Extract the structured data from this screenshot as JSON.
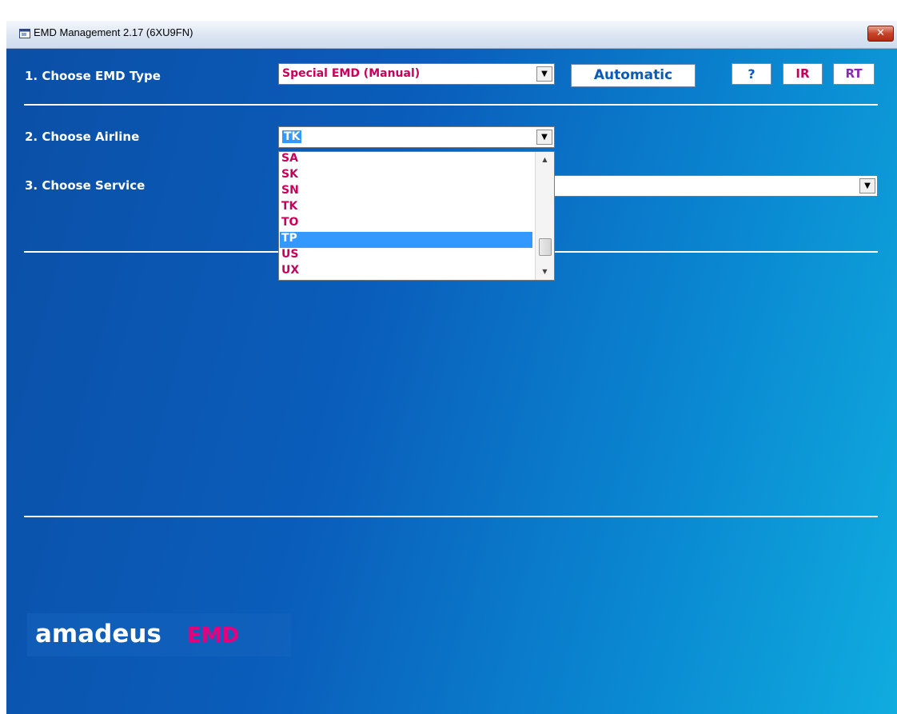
{
  "window": {
    "title": "EMD Management 2.17 (6XU9FN)",
    "close_glyph": "✕"
  },
  "step1": {
    "label": "1. Choose EMD Type",
    "emd_type_value": "Special EMD (Manual)",
    "automatic_button": "Automatic",
    "help_button": "?",
    "ir_button": "IR",
    "rt_button": "RT"
  },
  "step2": {
    "label": "2. Choose Airline",
    "airline_value": "TK",
    "options": [
      "SA",
      "SK",
      "SN",
      "TK",
      "TO",
      "TP",
      "US",
      "UX"
    ],
    "highlighted_option": "TP"
  },
  "step3": {
    "label": "3. Choose Service",
    "service_value": ""
  },
  "logo": {
    "brand": "amadeus",
    "product": "EMD"
  },
  "colors": {
    "value_text": "#c8005a",
    "selection": "#3399ff",
    "background_from": "#0b4fa6",
    "background_to": "#10acdf"
  }
}
